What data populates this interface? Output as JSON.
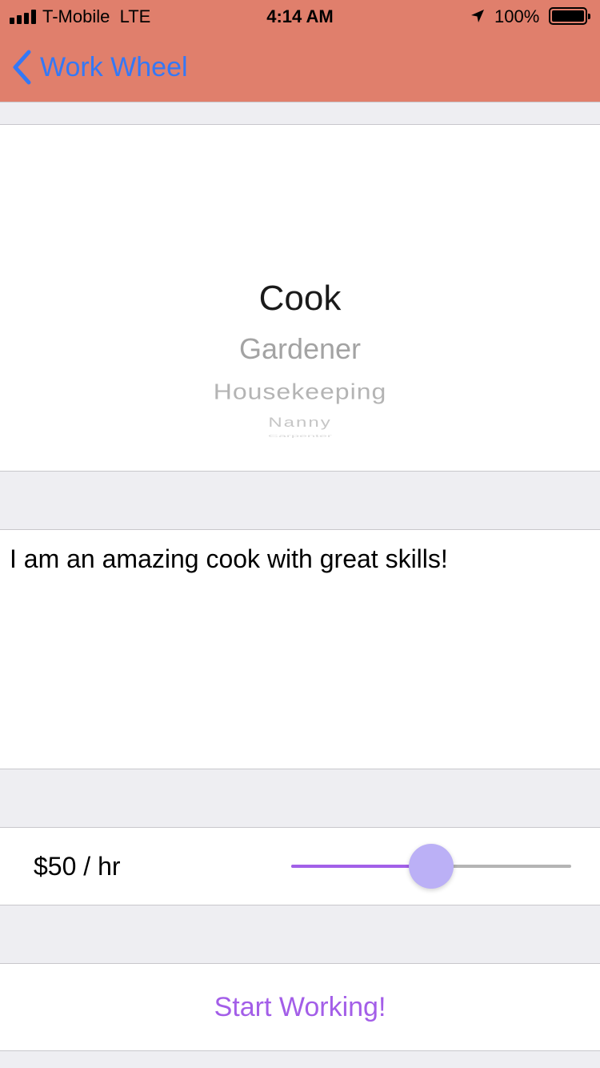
{
  "status_bar": {
    "carrier": "T-Mobile",
    "network": "LTE",
    "time": "4:14 AM",
    "battery_percent": "100%",
    "battery_level": 1.0,
    "signal_bars": 4
  },
  "nav": {
    "back_label": "Work Wheel",
    "back_icon": "chevron-left-icon",
    "colors": {
      "bar_background": "#e07f6c",
      "tint": "#3478f6"
    }
  },
  "picker": {
    "selected": "Cook",
    "items": [
      "Cook",
      "Gardener",
      "Housekeeping",
      "Nanny",
      "Carpenter"
    ]
  },
  "description": {
    "text": "I am an amazing cook with great skills!"
  },
  "rate": {
    "label": "$50 / hr",
    "slider_value_fraction": 0.5,
    "colors": {
      "fill": "#a260e8",
      "thumb": "#bbb0f6",
      "track": "#b4b4b4"
    }
  },
  "actions": {
    "start_label": "Start Working!",
    "color": "#a35ee8"
  }
}
